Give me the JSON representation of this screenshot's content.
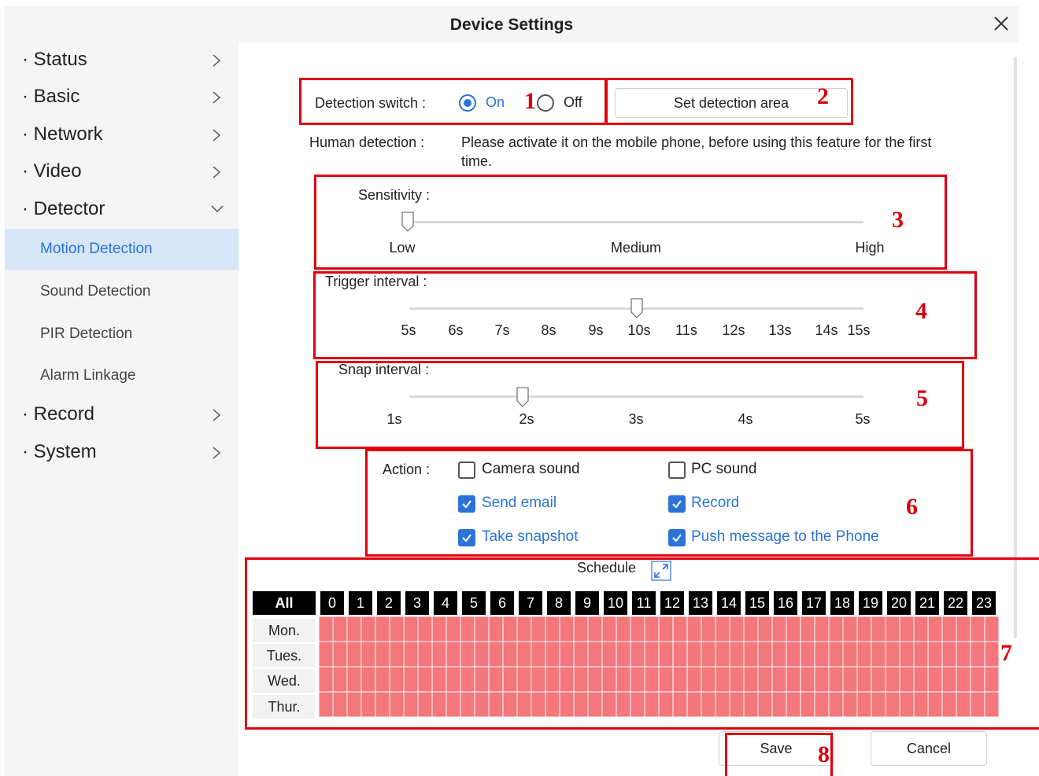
{
  "dialog": {
    "title": "Device Settings"
  },
  "sidebar": {
    "items": [
      {
        "label": "· Status"
      },
      {
        "label": "· Basic"
      },
      {
        "label": "· Network"
      },
      {
        "label": "· Video"
      },
      {
        "label": "· Detector",
        "expanded": true
      },
      {
        "label": "· Record"
      },
      {
        "label": "· System"
      }
    ],
    "detector_subitems": [
      {
        "label": "Motion Detection",
        "active": true
      },
      {
        "label": "Sound Detection"
      },
      {
        "label": "PIR Detection"
      },
      {
        "label": "Alarm Linkage"
      }
    ]
  },
  "detection": {
    "switch_label": "Detection switch :",
    "on_label": "On",
    "off_label": "Off",
    "selected": "On",
    "set_area_button": "Set detection area",
    "human_label": "Human detection :",
    "human_text_line1": "Please activate it on the mobile phone, before using this feature for the first",
    "human_text_line2": "time."
  },
  "sensitivity": {
    "label": "Sensitivity :",
    "ticks": [
      "Low",
      "Medium",
      "High"
    ],
    "value": "Low"
  },
  "trigger": {
    "label": "Trigger interval :",
    "ticks": [
      "5s",
      "6s",
      "7s",
      "8s",
      "9s",
      "10s",
      "11s",
      "12s",
      "13s",
      "14s",
      "15s"
    ],
    "value": "10s"
  },
  "snap": {
    "label": "Snap interval :",
    "ticks": [
      "1s",
      "2s",
      "3s",
      "4s",
      "5s"
    ],
    "value": "2s"
  },
  "action": {
    "label": "Action :",
    "options": [
      {
        "label": "Camera sound",
        "checked": false
      },
      {
        "label": "PC sound",
        "checked": false
      },
      {
        "label": "Send email",
        "checked": true
      },
      {
        "label": "Record",
        "checked": true
      },
      {
        "label": "Take snapshot",
        "checked": true
      },
      {
        "label": "Push message to the Phone",
        "checked": true
      }
    ]
  },
  "schedule": {
    "title": "Schedule",
    "all_label": "All",
    "hours": [
      "0",
      "1",
      "2",
      "3",
      "4",
      "5",
      "6",
      "7",
      "8",
      "9",
      "10",
      "11",
      "12",
      "13",
      "14",
      "15",
      "16",
      "17",
      "18",
      "19",
      "20",
      "21",
      "22",
      "23"
    ],
    "days": [
      "Mon.",
      "Tues.",
      "Wed.",
      "Thur."
    ],
    "cell_color": "#f4777c",
    "grid_line_color": "#ffffff"
  },
  "buttons": {
    "save": "Save",
    "cancel": "Cancel"
  },
  "annotations": [
    "1",
    "2",
    "3",
    "4",
    "5",
    "6",
    "7",
    "8"
  ],
  "colors": {
    "accent": "#2b73d8",
    "annotation_red": "#e0000f",
    "active_bg": "#d7e6f9"
  }
}
